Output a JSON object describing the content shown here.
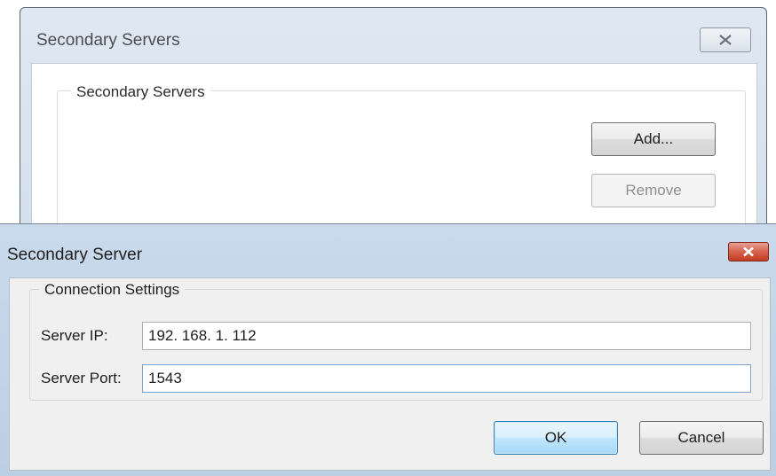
{
  "back_window": {
    "title": "Secondary Servers",
    "group_label": "Secondary Servers",
    "add_button": "Add...",
    "remove_button": "Remove"
  },
  "dialog": {
    "title": "Secondary Server",
    "group_label": "Connection Settings",
    "server_ip": {
      "label": "Server IP:",
      "value": "192. 168. 1. 112"
    },
    "server_port": {
      "label": "Server Port:",
      "value": "1543"
    },
    "ok_button": "OK",
    "cancel_button": "Cancel"
  },
  "icons": {
    "back_close": "close-icon",
    "dialog_close": "close-icon"
  },
  "colors": {
    "dialog_close_bg": "#c9442c",
    "ok_border": "#3c7fb1"
  }
}
